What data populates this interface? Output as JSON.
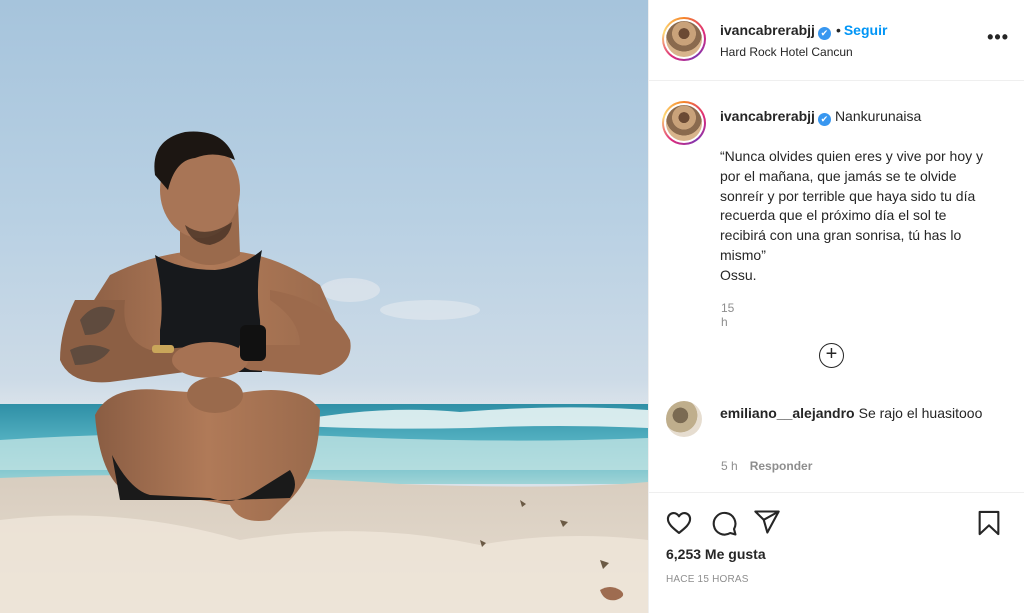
{
  "header": {
    "username": "ivancabrerabjj",
    "verified_mark": "✔",
    "separator": "•",
    "follow_label": "Seguir",
    "location": "Hard Rock Hotel Cancun",
    "more_label": "•••"
  },
  "caption": {
    "username": "ivancabrerabjj",
    "tagline": "Nankurunaisa",
    "text": "“Nunca olvides quien eres y vive por hoy y por el mañana, que jamás se te olvide sonreír y por terrible que haya sido tu día recuerda que el próximo día el sol te recibirá con una gran sonrisa, tú has lo mismo”\nOssu.",
    "time": "15 h"
  },
  "load_more_label": "+",
  "comment": {
    "username": "emiliano__alejandro",
    "text": "Se rajo el huasitooo",
    "time": "5 h",
    "reply_label": "Responder"
  },
  "actions": {
    "likes": "6,253 Me gusta",
    "posted_ago": "Hace 15 horas",
    "icons": [
      "heart-icon",
      "comment-icon",
      "share-icon",
      "bookmark-icon"
    ]
  },
  "colors": {
    "accent": "#0095f6",
    "text": "#262626",
    "muted": "#8e8e8e",
    "border": "#efefef"
  }
}
